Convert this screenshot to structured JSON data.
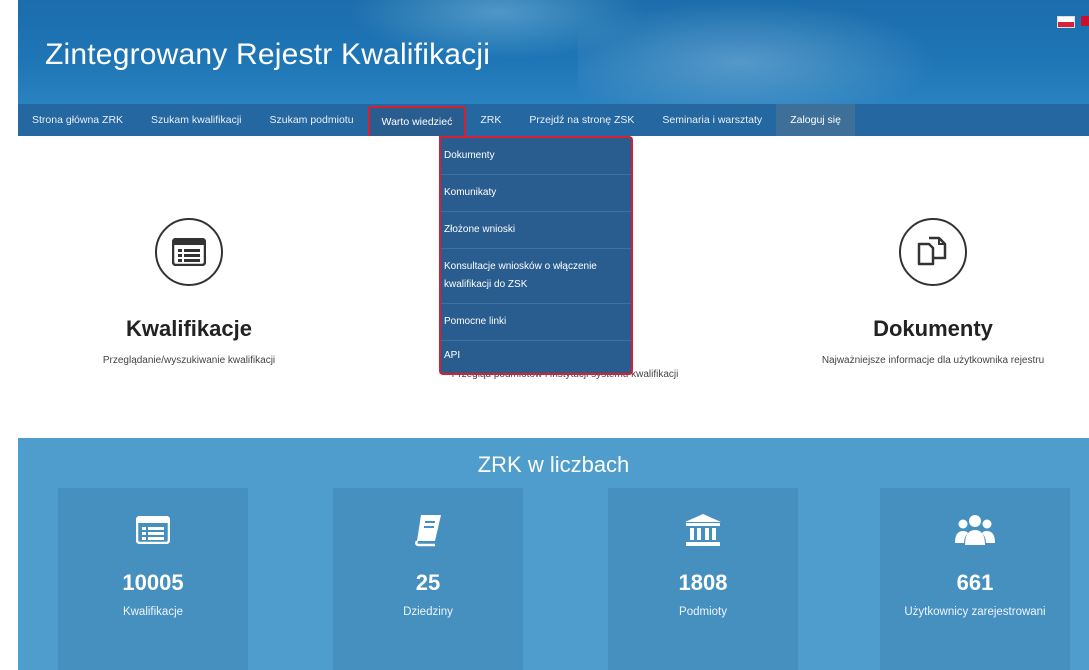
{
  "header": {
    "title": "Zintegrowany Rejestr Kwalifikacji"
  },
  "nav": {
    "items": [
      "Strona główna ZRK",
      "Szukam kwalifikacji",
      "Szukam podmiotu",
      "Warto wiedzieć",
      "ZRK",
      "Przejdź na stronę ZSK",
      "Seminaria i warsztaty",
      "Zaloguj się"
    ]
  },
  "dropdown": {
    "items": [
      "Dokumenty",
      "Komunikaty",
      "Złożone wnioski",
      "Konsultacje wniosków o włączenie kwalifikacji do ZSK",
      "Pomocne linki",
      "API"
    ]
  },
  "features": [
    {
      "title": "Kwalifikacje",
      "desc": "Przeglądanie/wyszukiwanie kwalifikacji",
      "icon": "list-icon"
    },
    {
      "title": "",
      "desc": "Przegląd podmiotów i instytucji systemu kwalifikacji",
      "icon": "institution-icon"
    },
    {
      "title": "Dokumenty",
      "desc": "Najważniejsze informacje dla użytkownika rejestru",
      "icon": "documents-icon"
    }
  ],
  "stats": {
    "title": "ZRK w liczbach",
    "boxes": [
      {
        "number": "10005",
        "label": "Kwalifikacje",
        "icon": "list-icon"
      },
      {
        "number": "25",
        "label": "Dziedziny",
        "icon": "book-icon"
      },
      {
        "number": "1808",
        "label": "Podmioty",
        "icon": "institution-icon"
      },
      {
        "number": "661",
        "label": "Użytkownicy zarejestrowani",
        "icon": "users-icon"
      }
    ]
  },
  "colors": {
    "header": "#1e75b5",
    "nav": "#2567a0",
    "highlight": "#d91f2f",
    "stats_bg": "#4e9dcd"
  }
}
